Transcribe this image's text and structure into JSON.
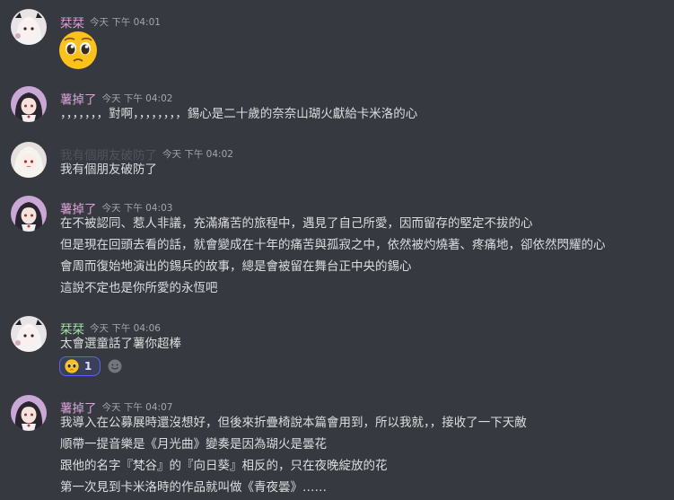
{
  "messages": [
    {
      "username": "栞栞",
      "username_color": "#e09bd7",
      "timestamp": "今天 下午 04:01",
      "avatar": "white-haired-girl-avatar",
      "emoji": "pleading-face-emoji"
    },
    {
      "username": "薯掉了",
      "username_color": "#e0a0d8",
      "timestamp": "今天 下午 04:02",
      "avatar": "dark-haired-girl-avatar",
      "lines": [
        "，，，，，，，對啊，，，，，，，，錫心是二十歲的奈奈山瑚火獻給卡米洛的心"
      ]
    },
    {
      "username": "我有個朋友破防了",
      "username_color": "#4f545c",
      "timestamp": "今天 下午 04:02",
      "avatar": "white-haired-red-eyed-avatar",
      "lines": [
        "我有個朋友破防了"
      ]
    },
    {
      "username": "薯掉了",
      "username_color": "#e0a0d8",
      "timestamp": "今天 下午 04:03",
      "avatar": "dark-haired-girl-avatar",
      "lines": [
        "在不被認同、惹人非議，充滿痛苦的旅程中，遇見了自己所愛，因而留存的堅定不拔的心",
        "但是現在回頭去看的話，就會變成在十年的痛苦與孤寂之中，依然被灼燒著、疼痛地，卻依然閃耀的心",
        "會周而復始地演出的錫兵的故事，總是會被留在舞台正中央的錫心",
        "這說不定也是你所愛的永恆吧"
      ]
    },
    {
      "username": "栞栞",
      "username_color": "#a6e0a6",
      "timestamp": "今天 下午 04:06",
      "avatar": "white-haired-girl-avatar",
      "lines": [
        "太會選童話了薯你超棒"
      ],
      "reaction": {
        "emoji": "pleading-face-emoji",
        "count": "1"
      },
      "add_reaction_icon": "add-reaction-icon"
    },
    {
      "username": "薯掉了",
      "username_color": "#e0a0d8",
      "timestamp": "今天 下午 04:07",
      "avatar": "dark-haired-girl-avatar",
      "lines": [
        "我導入在公募展時還沒想好，但後來折疊椅說本篇會用到，所以我就，，接收了一下天敵",
        "順帶一提音樂是《月光曲》變奏是因為瑚火是曇花",
        "跟他的名字『梵谷』的『向日葵』相反的，只在夜晚綻放的花",
        "第一次見到卡米洛時的作品就叫做《青夜曇》……"
      ]
    }
  ]
}
